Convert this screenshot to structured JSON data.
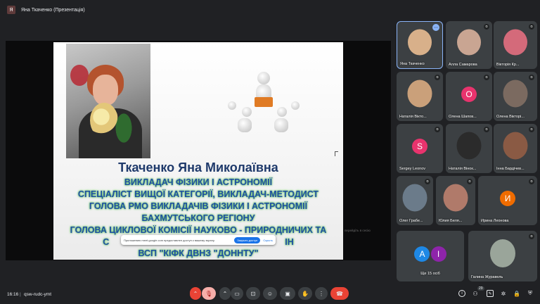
{
  "window": {
    "title": "Яна Ткаченко (Презентація)",
    "presenter_initial": "Я"
  },
  "slide": {
    "name": "Ткаченко Яна Миколаївна",
    "lines": [
      "ВИКЛАДАЧ ФІЗИКИ І АСТРОНОМІЇ",
      "СПЕЦІАЛІСТ ВИЩОЇ КАТЕГОРІЇ, ВИКЛАДАЧ-МЕТОДИСТ",
      "ГОЛОВА РМО ВИКЛАДАЧІВ ФІЗИКИ І АСТРОНОМІЇ",
      "БАХМУТСЬКОГО РЕГІОНУ",
      "ГОЛОВА ЦИКЛОВОЇ КОМІСІЇ НАУКОВО - ПРИРОДНИЧИХ ТА",
      "С                                                                        ІН",
      "ВСП \"КІФК ДВНЗ \"ДОННТУ\""
    ]
  },
  "share_banner": {
    "text": "Приложению meet.google.com предоставлен доступ к вашему экрану.",
    "stop_label": "Закрыть доступ",
    "hide_label": "Скрыть"
  },
  "stage_hint": "перейдіть в сесію",
  "participants": [
    {
      "name": "Яна Ткаченко",
      "kind": "photo",
      "color": "#d8b08a"
    },
    {
      "name": "Алла Самарова",
      "kind": "photo",
      "color": "#c9a592"
    },
    {
      "name": "Вікторія Кр...",
      "kind": "photo",
      "color": "#d46a7a"
    },
    {
      "name": "Наталія Вікто...",
      "kind": "photo",
      "color": "#caa07a"
    },
    {
      "name": "Олена Шапов...",
      "kind": "letter",
      "letter": "О",
      "color": "#e8336d"
    },
    {
      "name": "Олена Вікторі...",
      "kind": "photo",
      "color": "#7b6a60"
    },
    {
      "name": "Sergey Leonov",
      "kind": "letter",
      "letter": "S",
      "color": "#e8336d"
    },
    {
      "name": "Наталія Вінок...",
      "kind": "photo",
      "color": "#2b2b2b"
    },
    {
      "name": "Інна Бардічев...",
      "kind": "photo",
      "color": "#8a5a44"
    },
    {
      "name": "Олег Грабе...",
      "kind": "photo",
      "color": "#6b7b8a"
    },
    {
      "name": "Юлия Беля...",
      "kind": "photo",
      "color": "#b07a6a"
    },
    {
      "name": "Ирина Леонова",
      "kind": "letter",
      "letter": "И",
      "color": "#ef6c00"
    },
    {
      "name": "Ще 15 осіб",
      "kind": "group",
      "letters": [
        "А",
        "І"
      ],
      "colors": [
        "#1e88e5",
        "#8e24aa"
      ]
    },
    {
      "name": "Галина Журавель",
      "kind": "photo",
      "color": "#9aa59a"
    }
  ],
  "bottom": {
    "time": "16:16",
    "separator": "|",
    "meeting_code": "qsw-rudc-ymt",
    "participants_count": "29"
  }
}
